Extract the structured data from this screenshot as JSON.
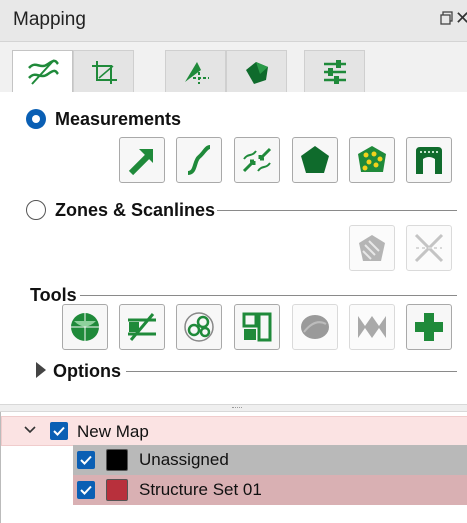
{
  "panel": {
    "title": "Mapping"
  },
  "tabs": [
    {
      "icon": "measurement-curves-icon",
      "active": true
    },
    {
      "icon": "crop-axes-icon",
      "active": false
    },
    {
      "icon": "points-axis-icon",
      "active": false
    },
    {
      "icon": "solid-polygon-icon",
      "active": false
    },
    {
      "icon": "settings-sliders-icon",
      "active": false
    }
  ],
  "sections": {
    "measurements": {
      "label": "Measurements",
      "selected": true,
      "tools": [
        "arrow-icon",
        "s-curve-icon",
        "converge-lines-icon",
        "pentagon-icon",
        "dotted-polygon-icon",
        "arch-icon"
      ]
    },
    "zones": {
      "label": "Zones & Scanlines",
      "selected": false,
      "tools": [
        "hatched-polygon-icon",
        "crossed-lines-icon"
      ]
    },
    "tools": {
      "label": "Tools",
      "tools": [
        "stereonet-icon",
        "plane-intersect-icon",
        "ring-set-icon",
        "tiled-layout-icon",
        "sphere-icon",
        "zigzag-icon",
        "plus-icon"
      ]
    },
    "options": {
      "label": "Options"
    }
  },
  "tree": {
    "root": {
      "label": "New Map",
      "checked": true,
      "expanded": true
    },
    "children": [
      {
        "label": "Unassigned",
        "checked": true,
        "color": "#000000"
      },
      {
        "label": "Structure Set 01",
        "checked": true,
        "color": "#b8303c"
      }
    ]
  },
  "colors": {
    "accent": "#0a5fb4",
    "tool_green": "#1f8a3a",
    "disabled_gray": "#c9c9c9"
  }
}
